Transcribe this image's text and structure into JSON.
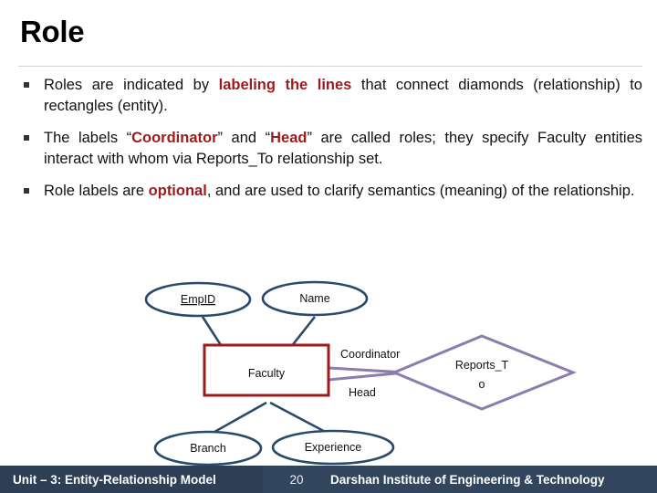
{
  "slide": {
    "title": "Role"
  },
  "bullets": [
    {
      "id": "bullet-roles-indicated",
      "segments": [
        {
          "text": "Roles are indicated by ",
          "highlight": false
        },
        {
          "text": "labeling the lines",
          "highlight": true
        },
        {
          "text": " that connect diamonds (relationship) to rectangles (entity).",
          "highlight": false
        }
      ]
    },
    {
      "id": "bullet-labels-coordinator-head",
      "segments": [
        {
          "text": "The labels “",
          "highlight": false
        },
        {
          "text": "Coordinator",
          "highlight": true
        },
        {
          "text": "” and “",
          "highlight": false
        },
        {
          "text": "Head",
          "highlight": true
        },
        {
          "text": "” are called roles; they specify Faculty entities interact with whom via Reports_To relationship set.",
          "highlight": false
        }
      ]
    },
    {
      "id": "bullet-role-labels-optional",
      "segments": [
        {
          "text": "Role labels are ",
          "highlight": false
        },
        {
          "text": "optional",
          "highlight": true
        },
        {
          "text": ", and are used to clarify semantics (meaning) of the relationship.",
          "highlight": false
        }
      ]
    }
  ],
  "diagram": {
    "entity": {
      "label": "Faculty"
    },
    "relationship": {
      "label_line1": "Reports_T",
      "label_line2": "o",
      "full_label": "Reports_To"
    },
    "attributes": [
      {
        "label": "EmpID",
        "key": true
      },
      {
        "label": "Name",
        "key": false
      },
      {
        "label": "Branch",
        "key": false
      },
      {
        "label": "Experience",
        "key": false
      }
    ],
    "roles": [
      {
        "label": "Coordinator"
      },
      {
        "label": "Head"
      }
    ],
    "colors": {
      "attribute_stroke": "#2A4A6B",
      "entity_stroke": "#9E1B1B",
      "relationship_stroke": "#8B7DAE",
      "connector_entity": "#2A4A6B",
      "connector_role": "#8B7DAE",
      "accent_red": "#9E1B1B",
      "footer_bg": "#31465C",
      "footer_bg_left": "#2C3F54"
    }
  },
  "footer": {
    "unit": "Unit – 3: Entity-Relationship Model",
    "page": "20",
    "institute": "Darshan Institute of Engineering & Technology"
  }
}
